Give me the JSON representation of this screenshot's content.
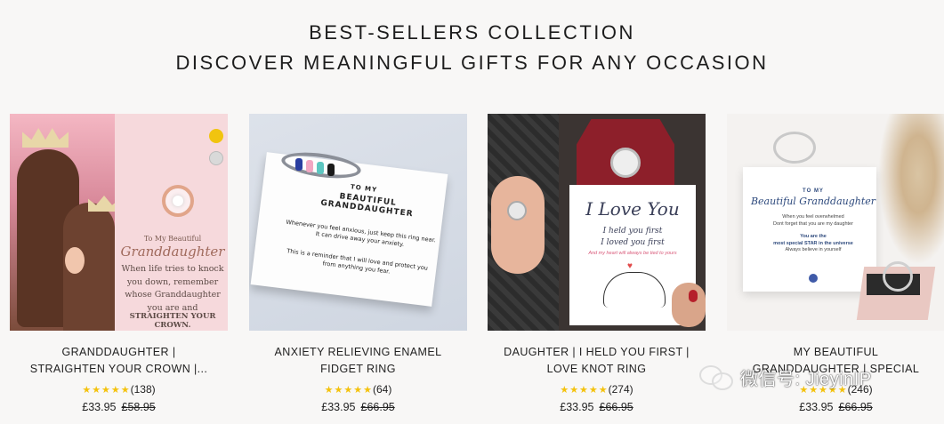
{
  "heading": {
    "line1": "BEST-SELLERS COLLECTION",
    "line2": "DISCOVER MEANINGFUL GIFTS FOR ANY OCCASION"
  },
  "products": [
    {
      "title_line1": "GRANDDAUGHTER |",
      "title_line2": "STRAIGHTEN YOUR CROWN |...",
      "stars": "★★★★★",
      "reviews": "(138)",
      "price": "£33.95",
      "old_price": "£58.95",
      "image": {
        "small": "To My Beautiful",
        "name": "Granddaughter",
        "body1": "When life tries to knock",
        "body2": "you down, remember",
        "body3": "whose Granddaughter",
        "body4": "you are and",
        "body5": "STRAIGHTEN YOUR CROWN.",
        "swatches": [
          "#f1c40f",
          "#d9d9d9"
        ]
      }
    },
    {
      "title_line1": "ANXIETY RELIEVING ENAMEL",
      "title_line2": "FIDGET RING",
      "stars": "★★★★★",
      "reviews": "(64)",
      "price": "£33.95",
      "old_price": "£66.95",
      "image": {
        "small": "TO MY",
        "name": "BEAUTIFUL GRANDDAUGHTER",
        "body1": "Whenever you feel anxious, just keep this ring near. It can drive away your anxiety.",
        "body2": "This is a reminder that I will love and protect you from anything you fear."
      }
    },
    {
      "title_line1": "DAUGHTER | I HELD YOU FIRST |",
      "title_line2": "LOVE KNOT RING",
      "stars": "★★★★★",
      "reviews": "(274)",
      "price": "£33.95",
      "old_price": "£66.95",
      "image": {
        "headline": "I Love You",
        "line1": "I held you first",
        "line2": "I loved you first",
        "line3": "And my heart will always be tied to yours"
      }
    },
    {
      "title_line1": "MY BEAUTIFUL",
      "title_line2": "GRANDDAUGHTER | SPECIAL",
      "stars": "★★★★★",
      "reviews": "(246)",
      "price": "£33.95",
      "old_price": "£66.95",
      "image": {
        "small": "TO MY",
        "name": "Beautiful Granddaughter",
        "body1": "When you feel overwhelmed",
        "body2": "Dont forget that you are my daughter",
        "body3": "You are the",
        "body4": "most special STAR in the universe",
        "body5": "Always believe in yourself"
      }
    }
  ],
  "watermark": {
    "text": "微信号: JieyinIP"
  }
}
